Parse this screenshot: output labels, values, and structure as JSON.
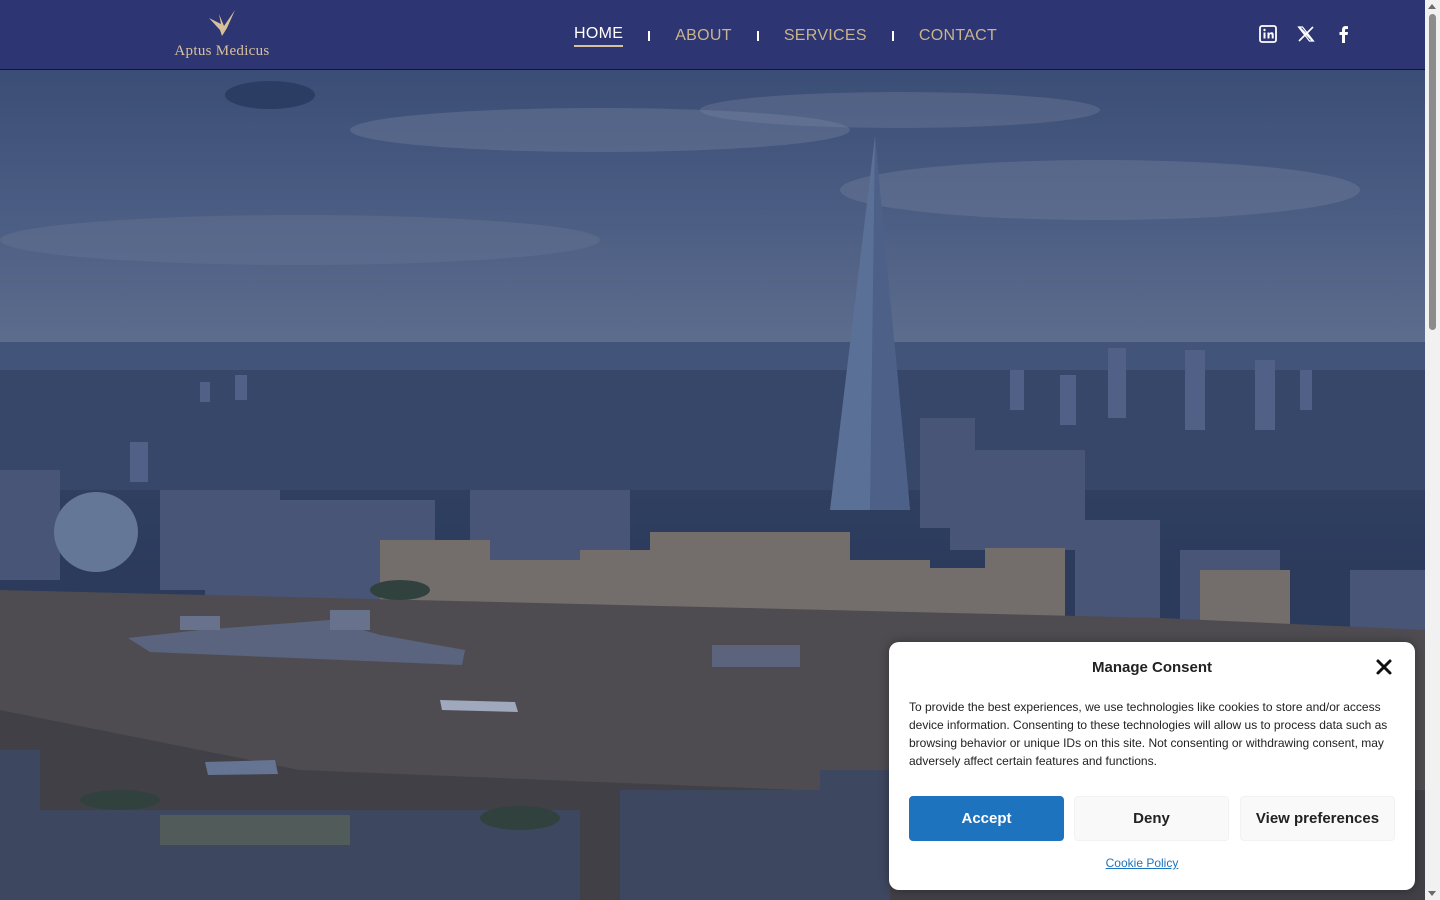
{
  "brand": {
    "name": "Aptus Medicus",
    "logo_icon": "bird-logo-icon",
    "accent": "#d8c19a"
  },
  "header": {
    "background": "#2d3572"
  },
  "nav": {
    "items": [
      {
        "label": "HOME",
        "active": true
      },
      {
        "label": "ABOUT",
        "active": false
      },
      {
        "label": "SERVICES",
        "active": false
      },
      {
        "label": "CONTACT",
        "active": false
      }
    ]
  },
  "social": {
    "icons": [
      "linkedin-icon",
      "x-twitter-icon",
      "facebook-icon"
    ]
  },
  "hero": {
    "description_icon": "city-skyline-photo"
  },
  "consent": {
    "title": "Manage Consent",
    "message": "To provide the best experiences, we use technologies like cookies to store and/or access device information. Consenting to these technologies will allow us to process data such as browsing behavior or unique IDs on this site. Not consenting or withdrawing consent, may adversely affect certain features and functions.",
    "accept_label": "Accept",
    "deny_label": "Deny",
    "prefs_label": "View preferences",
    "policy_label": "Cookie Policy",
    "accent": "#1e73be"
  }
}
